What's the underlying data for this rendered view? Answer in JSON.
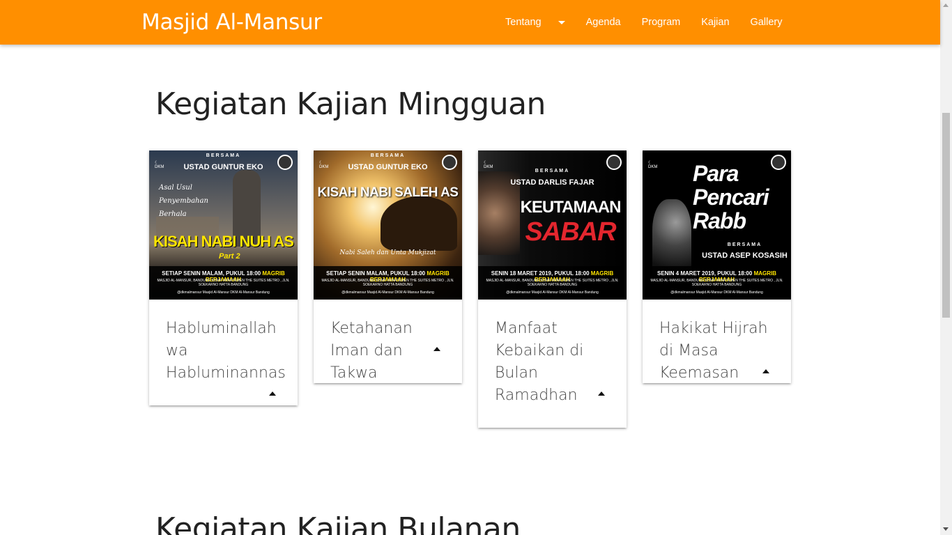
{
  "navbar": {
    "brand": "Masjid Al-Mansur",
    "links": [
      {
        "label": "Tentang"
      },
      {
        "label": "Agenda"
      },
      {
        "label": "Program"
      },
      {
        "label": "Kajian"
      },
      {
        "label": "Gallery"
      }
    ]
  },
  "sections": {
    "weekly_title": "Kegiatan Kajian Mingguan",
    "monthly_title": "Kegiatan Kajian Bulanan"
  },
  "cards": [
    {
      "title": "Habluminallah wa Habluminannas",
      "poster": {
        "top": "BERSAMA",
        "ustad": "USTAD GUNTUR EKO",
        "script": "Asal Usul Penyembahan Berhala",
        "main": "KISAH NABI NUH AS",
        "sub": "Part 2",
        "line1_a": "SETIAP SENIN MALAM, PUKUL 18:00",
        "line1_b": "MAGRIB BERJAMAAH",
        "line2": "MASJID AL-MANSUR, BANDUNG KOMP. APARTEMEN THE SUITES METRO , JLN. SOEKARNO HATTA BANDUNG",
        "social": "@dkmalmansur   Masjid Al-Mansur   DKM Al-Mansur Bandung"
      }
    },
    {
      "title": "Ketahanan Iman dan Takwa",
      "poster": {
        "top": "BERSAMA",
        "ustad": "USTAD GUNTUR EKO",
        "script": "Nabi Saleh dan Unta Mukjizat",
        "main": "KISAH NABI SALEH AS",
        "line1_a": "SETIAP SENIN MALAM, PUKUL 18:00",
        "line1_b": "MAGRIB BERJAMAAH",
        "line2": "MASJID AL-MANSUR, BANDUNG KOMP. APARTEMEN THE SUITES METRO , JLN. SOEKARNO HATTA BANDUNG",
        "social": "@dkmalmansur   Masjid Al-Mansur   DKM Al-Mansur Bandung"
      }
    },
    {
      "title": "Manfaat Kebaikan di Bulan Ramadhan",
      "poster": {
        "top": "BERSAMA",
        "ustad": "USTAD DARLIS FAJAR",
        "main": "KEUTAMAAN",
        "main2": "SABAR",
        "line1_a": "SENIN 18 MARET 2019, PUKUL 18:00",
        "line1_b": "MAGRIB BERJAMAAH",
        "line2": "MASJID AL-MANSUR, BANDUNG KOMP. APARTEMEN THE SUITES METRO , JLN. SOEKARNO HATTA BANDUNG",
        "social": "@dkmalmansur   Masjid Al-Mansur   DKM Al-Mansur Bandung"
      }
    },
    {
      "title": "Hakikat Hijrah di Masa Keemasan",
      "poster": {
        "main": "Para Pencari Rabb",
        "top": "BERSAMA",
        "ustad": "USTAD ASEP KOSASIH",
        "line1_a": "SENIN 4 MARET 2019, PUKUL 18:00",
        "line1_b": "MAGRIB BERJAMAAH",
        "line2": "MASJID AL-MANSUR, BANDUNG KOMP. APARTEMEN THE SUITES METRO , JLN. SOEKARNO HATTA BANDUNG",
        "social": "@dkmalmansur   Masjid Al-Mansur   DKM Al-Mansur Bandung"
      }
    }
  ],
  "colors": {
    "navbar": "#ff8f00",
    "text": "#222222",
    "card_title": "#444444",
    "poster_accent": "#ffe500",
    "poster_red": "#e3262e"
  },
  "icons": {
    "dropdown": "caret-down-icon",
    "card_toggle": "caret-up-icon"
  }
}
